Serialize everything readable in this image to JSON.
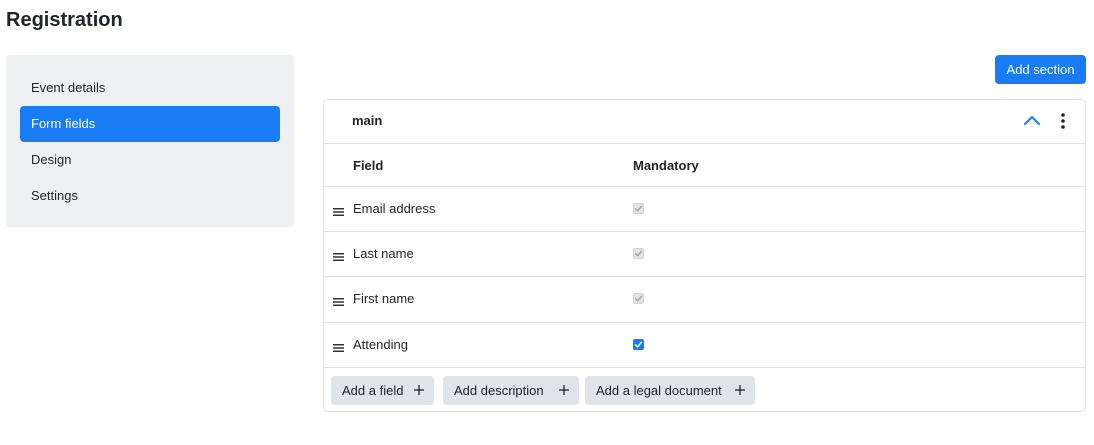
{
  "page": {
    "title": "Registration"
  },
  "sidebar": {
    "items": [
      {
        "label": "Event details",
        "active": false
      },
      {
        "label": "Form fields",
        "active": true
      },
      {
        "label": "Design",
        "active": false
      },
      {
        "label": "Settings",
        "active": false
      }
    ]
  },
  "toolbar": {
    "add_section_label": "Add section"
  },
  "section": {
    "name": "main",
    "icons": {
      "collapse": "chevron-up-icon",
      "menu": "more-vertical-icon"
    },
    "columns": {
      "field": "Field",
      "mandatory": "Mandatory"
    },
    "fields": [
      {
        "label": "Email address",
        "mandatory": true,
        "locked": true
      },
      {
        "label": "Last name",
        "mandatory": true,
        "locked": true
      },
      {
        "label": "First name",
        "mandatory": true,
        "locked": true
      },
      {
        "label": "Attending",
        "mandatory": true,
        "locked": false
      }
    ],
    "actions": {
      "add_field": "Add a field",
      "add_description": "Add description",
      "add_legal_document": "Add a legal document"
    }
  },
  "colors": {
    "accent": "#1a7cf4",
    "sidebar_bg": "#eff0f2",
    "secondary_button_bg": "#e0e3e7",
    "border": "#dee2e6"
  }
}
